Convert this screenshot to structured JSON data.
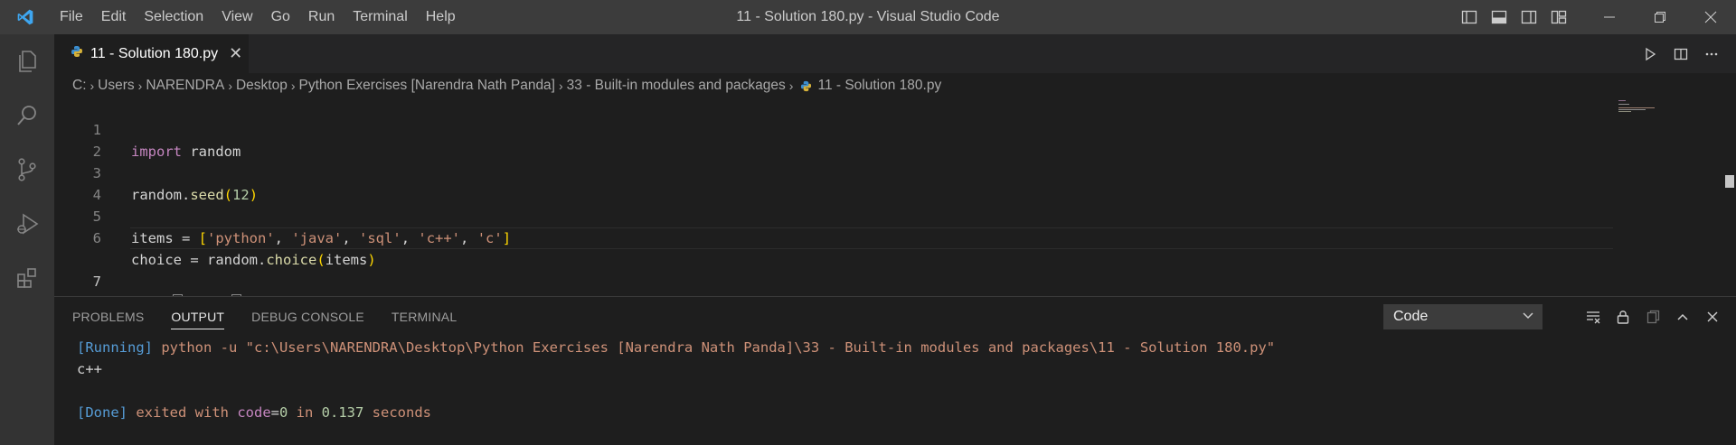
{
  "titlebar": {
    "menu": [
      "File",
      "Edit",
      "Selection",
      "View",
      "Go",
      "Run",
      "Terminal",
      "Help"
    ],
    "window_title": "11 - Solution 180.py - Visual Studio Code"
  },
  "activity_bar": {
    "items": [
      "explorer-icon",
      "search-icon",
      "source-control-icon",
      "run-debug-icon",
      "extensions-icon"
    ]
  },
  "editor": {
    "tab_label": "11 - Solution 180.py",
    "breadcrumb": [
      "C:",
      "Users",
      "NARENDRA",
      "Desktop",
      "Python Exercises [Narendra Nath Panda]",
      "33 - Built-in modules and packages",
      "11 - Solution 180.py"
    ],
    "line_numbers": [
      "1",
      "2",
      "3",
      "4",
      "5",
      "6",
      "7"
    ],
    "code": {
      "l1": {
        "kw": "import",
        "mod": " random"
      },
      "l3": {
        "obj": "random",
        "dot": ".",
        "fn": "seed",
        "open": "(",
        "num": "12",
        "close": ")"
      },
      "l5": {
        "var": "items",
        "eq": " = ",
        "open": "[",
        "s1": "'python'",
        "c1": ", ",
        "s2": "'java'",
        "c2": ", ",
        "s3": "'sql'",
        "c3": ", ",
        "s4": "'c++'",
        "c4": ", ",
        "s5": "'c'",
        "close": "]"
      },
      "l6": {
        "var": "choice",
        "eq": " = ",
        "obj": "random",
        "dot": ".",
        "fn": "choice",
        "open": "(",
        "arg": "items",
        "close": ")"
      },
      "l7": {
        "fn": "print",
        "open": "(",
        "arg": "choice",
        "close": ")"
      }
    }
  },
  "panel": {
    "tabs": [
      "PROBLEMS",
      "OUTPUT",
      "DEBUG CONSOLE",
      "TERMINAL"
    ],
    "active_tab": "OUTPUT",
    "channel_select": "Code",
    "output": {
      "running_tag": "[Running]",
      "command": " python -u \"c:\\Users\\NARENDRA\\Desktop\\Python Exercises [Narendra Nath Panda]\\33 - Built-in modules and packages\\11 - Solution 180.py\"",
      "result": "c++",
      "done_tag": "[Done]",
      "done_a": " exited with ",
      "done_code": "code",
      "done_eq": "=",
      "done_zero": "0",
      "done_in": " in ",
      "done_time": "0.137",
      "done_unit": " seconds"
    }
  }
}
